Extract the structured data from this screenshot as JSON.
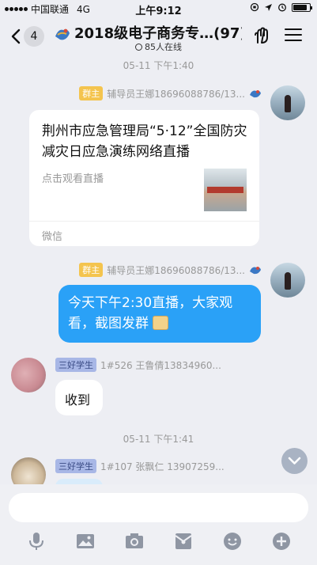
{
  "status_bar": {
    "carrier": "中国联通",
    "network": "4G",
    "time": "上午9:12"
  },
  "nav": {
    "back_count": "4",
    "title": "2018级电子商务专…(97)",
    "online": "85人在线"
  },
  "messages": {
    "ts1": "05-11 下午1:40",
    "ts2": "05-11 下午1:41",
    "msg1": {
      "role": "群主",
      "sender": "辅导员王娜18696088786/13...",
      "card_title": "荆州市应急管理局“5·12”全国防灾减灾日应急演练网络直播",
      "card_sub": "点击观看直播",
      "card_source": "微信"
    },
    "msg2": {
      "role": "群主",
      "sender": "辅导员王娜18696088786/13...",
      "text": "今天下午2:30直播，大家观看，截图发群"
    },
    "msg3": {
      "role": "三好学生",
      "sender": "1#526 王鲁倩13834960...",
      "text": "收到"
    },
    "msg4": {
      "role": "三好学生",
      "sender": "1#107  张飘仁  13907259..."
    }
  },
  "toolbar": {
    "items": [
      "microphone-icon",
      "image-icon",
      "camera-icon",
      "red-packet-icon",
      "emoji-icon",
      "plus-icon"
    ]
  },
  "colors": {
    "accent_blue": "#2aa1f7",
    "owner_badge": "#f4c44e",
    "student_badge": "#a8b7e6",
    "background": "#edeef3"
  }
}
